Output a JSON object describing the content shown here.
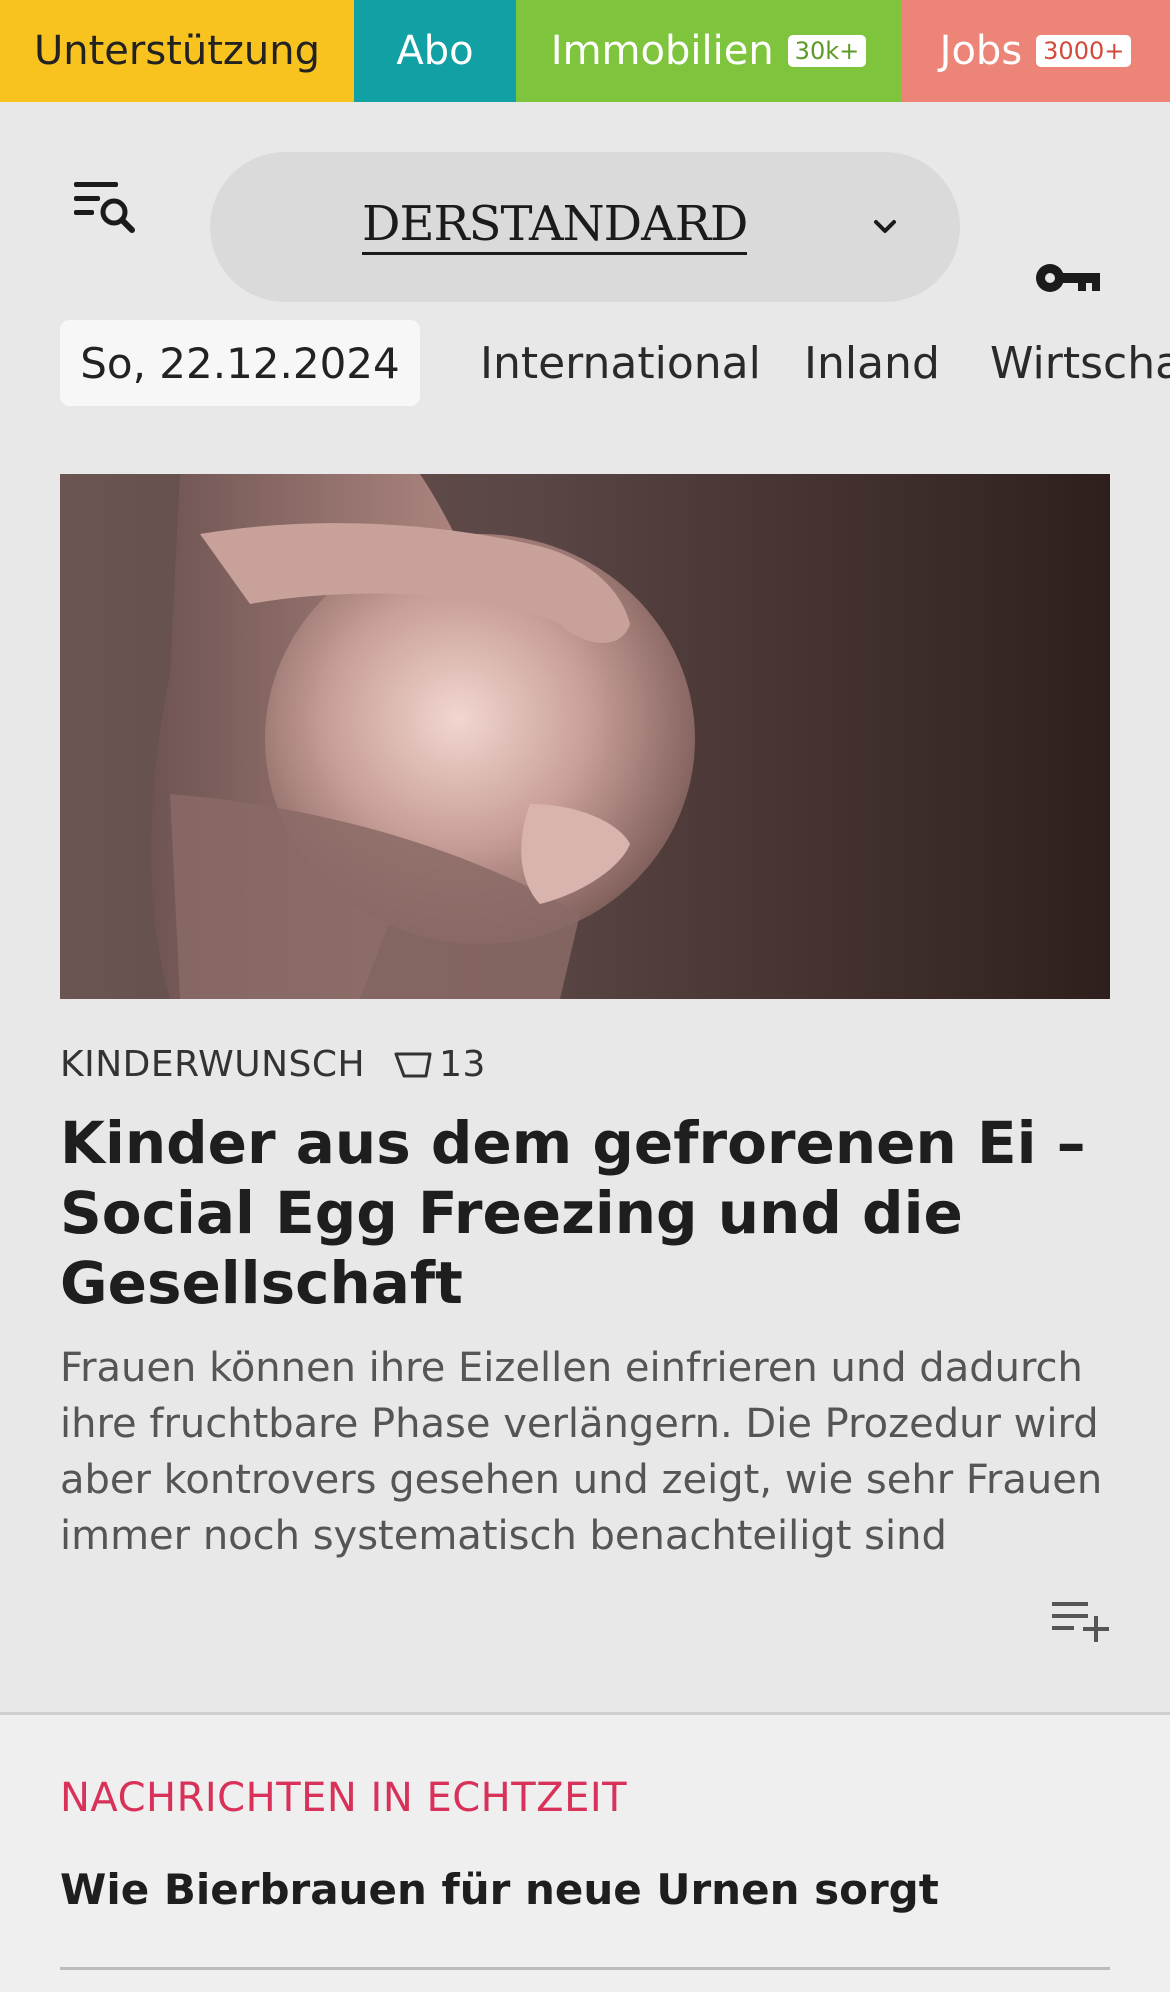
{
  "topbar": {
    "support": "Unterstützung",
    "abo": "Abo",
    "immobilien": "Immobilien",
    "immobilien_badge": "30k+",
    "jobs": "Jobs",
    "jobs_badge": "3000+"
  },
  "header": {
    "logo": "DERSTANDARD",
    "icons": [
      "menu-search-icon",
      "chevron-down-icon",
      "key-icon"
    ]
  },
  "nav": {
    "date": "So, 22.12.2024",
    "items": [
      "International",
      "Inland",
      "Wirtscha"
    ]
  },
  "article": {
    "kicker": "KINDERWUNSCH",
    "comment_count": "13",
    "headline": "Kinder aus dem gefrorenen Ei – Social Egg Freezing und die Gesellschaft",
    "lead": "Frauen können ihre Eizellen einfrieren und dadurch ihre fruchtbare Phase verlängern. Die Prozedur wird aber kontrovers gesehen und zeigt, wie sehr Frauen immer noch systematisch benachteiligt sind"
  },
  "realtime": {
    "title": "NACHRICHTEN IN ECHTZEIT",
    "item": "Wie Bierbrauen für neue Urnen sorgt"
  },
  "colors": {
    "support": "#f8c21f",
    "abo": "#11a0a3",
    "immobilien": "#7ec43c",
    "jobs": "#ec8477",
    "realtime_accent": "#d8325a",
    "background": "#e8e8e8"
  }
}
